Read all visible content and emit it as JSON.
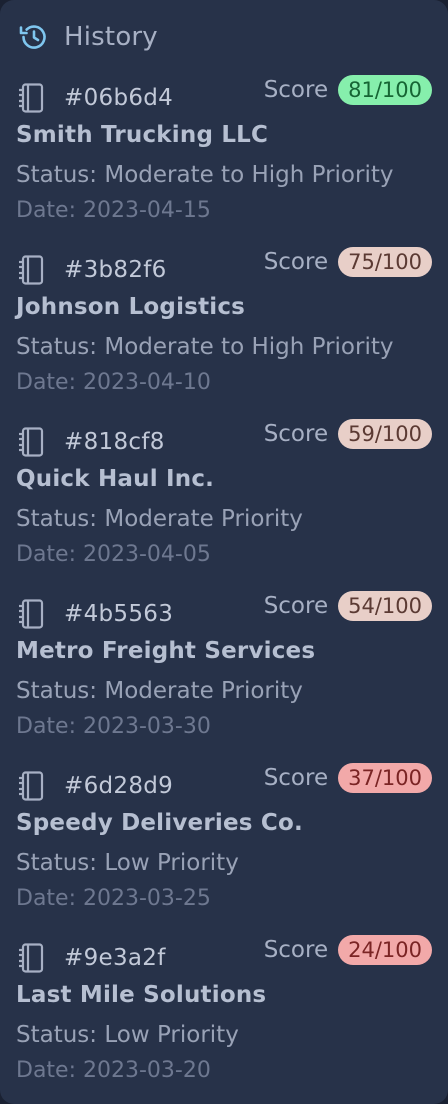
{
  "header": {
    "title": "History",
    "icon": "history-icon",
    "icon_color": "#7fc6ef"
  },
  "score_label": "Score",
  "items": [
    {
      "code": "#06b6d4",
      "name": "Smith Trucking LLC",
      "status": "Status: Moderate to High Priority",
      "date": "Date: 2023-04-15",
      "score": "81/100",
      "badge_bg": "#86efac",
      "badge_fg": "#166534"
    },
    {
      "code": "#3b82f6",
      "name": "Johnson Logistics",
      "status": "Status: Moderate to High Priority",
      "date": "Date: 2023-04-10",
      "score": "75/100",
      "badge_bg": "#e8cfc8",
      "badge_fg": "#5b3a33"
    },
    {
      "code": "#818cf8",
      "name": "Quick Haul Inc.",
      "status": "Status: Moderate Priority",
      "date": "Date: 2023-04-05",
      "score": "59/100",
      "badge_bg": "#e8cfc8",
      "badge_fg": "#5b3a33"
    },
    {
      "code": "#4b5563",
      "name": "Metro Freight Services",
      "status": "Status: Moderate Priority",
      "date": "Date: 2023-03-30",
      "score": "54/100",
      "badge_bg": "#e8cfc8",
      "badge_fg": "#5b3a33"
    },
    {
      "code": "#6d28d9",
      "name": "Speedy Deliveries Co.",
      "status": "Status: Low Priority",
      "date": "Date: 2023-03-25",
      "score": "37/100",
      "badge_bg": "#f2a9a9",
      "badge_fg": "#7a2424"
    },
    {
      "code": "#9e3a2f",
      "name": "Last Mile Solutions",
      "status": "Status: Low Priority",
      "date": "Date: 2023-03-20",
      "score": "24/100",
      "badge_bg": "#f2a9a9",
      "badge_fg": "#7a2424"
    }
  ]
}
